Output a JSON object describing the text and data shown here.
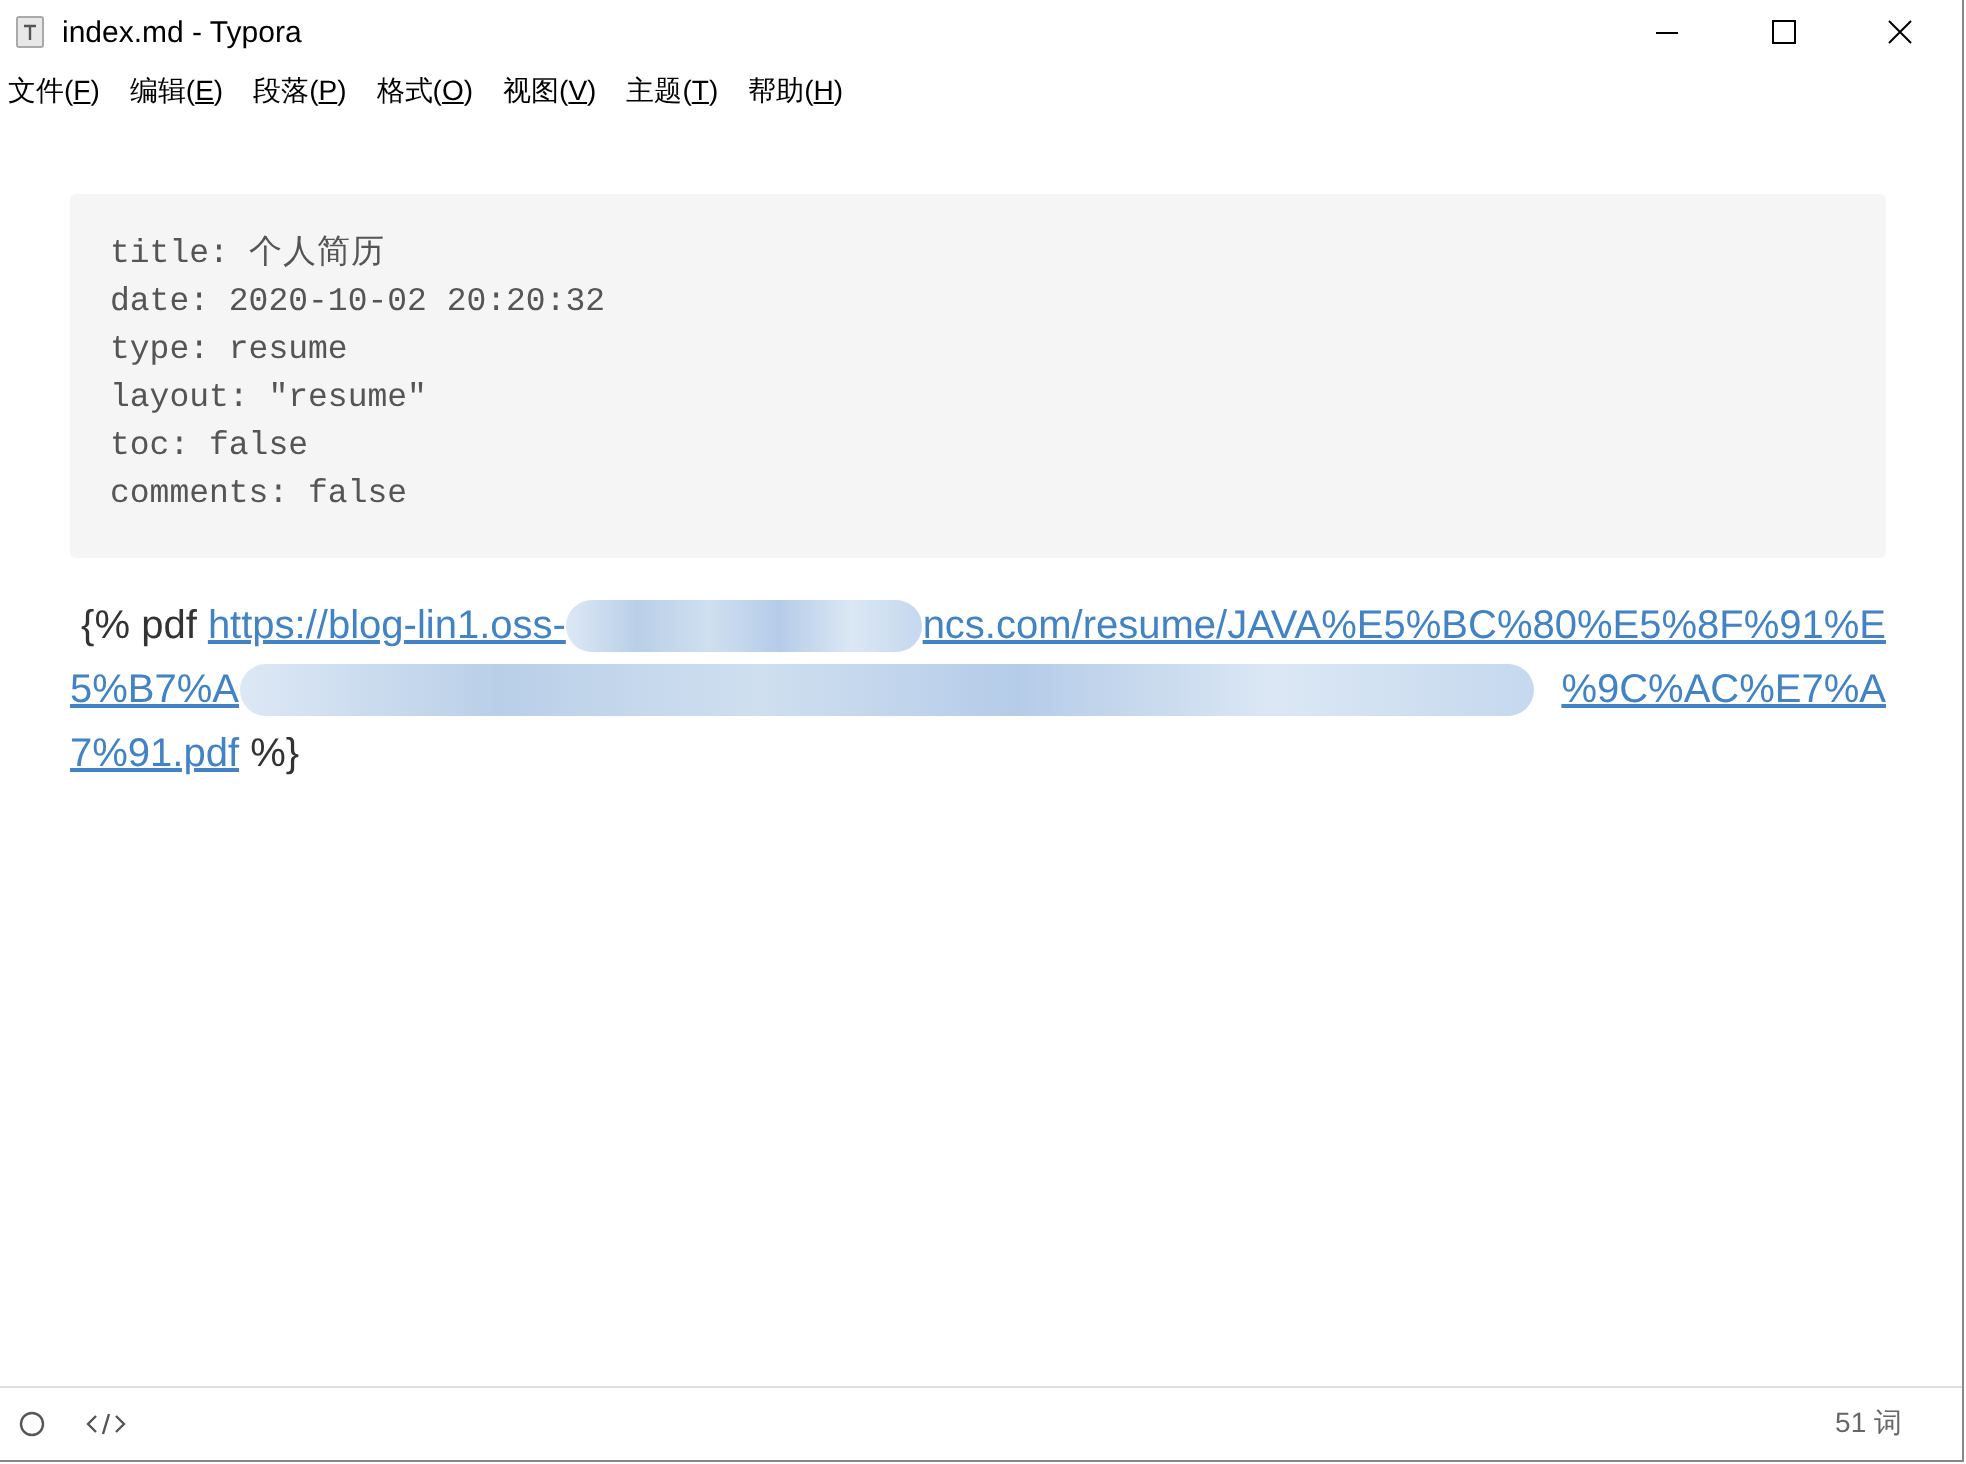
{
  "window": {
    "title": "index.md - Typora"
  },
  "menu": [
    {
      "label": "文件(F)"
    },
    {
      "label": "编辑(E)"
    },
    {
      "label": "段落(P)"
    },
    {
      "label": "格式(O)"
    },
    {
      "label": "视图(V)"
    },
    {
      "label": "主题(T)"
    },
    {
      "label": "帮助(H)"
    }
  ],
  "front_matter": [
    "title: 个人简历",
    "date: 2020-10-02 20:20:32",
    "type: resume",
    "layout: \"resume\"",
    "toc: false",
    "comments: false"
  ],
  "paragraph": [
    [
      {
        "kind": "text",
        "text": " {% pdf "
      },
      {
        "kind": "link",
        "text": "https://blog-lin1.oss-"
      },
      {
        "kind": "redacted"
      },
      {
        "kind": "link",
        "text": "ncs.com/resume/JAVA%E5%BC%80%E5%8F%91%E"
      }
    ],
    [
      {
        "kind": "link",
        "text": "5%B7%A"
      },
      {
        "kind": "redacted"
      },
      {
        "kind": "link",
        "text": "%9C%AC%E7%A"
      }
    ],
    [
      {
        "kind": "link",
        "text": "7%91.pdf"
      },
      {
        "kind": "text",
        "text": " %}"
      }
    ]
  ],
  "status_bar": {
    "word_count": "51 词"
  }
}
